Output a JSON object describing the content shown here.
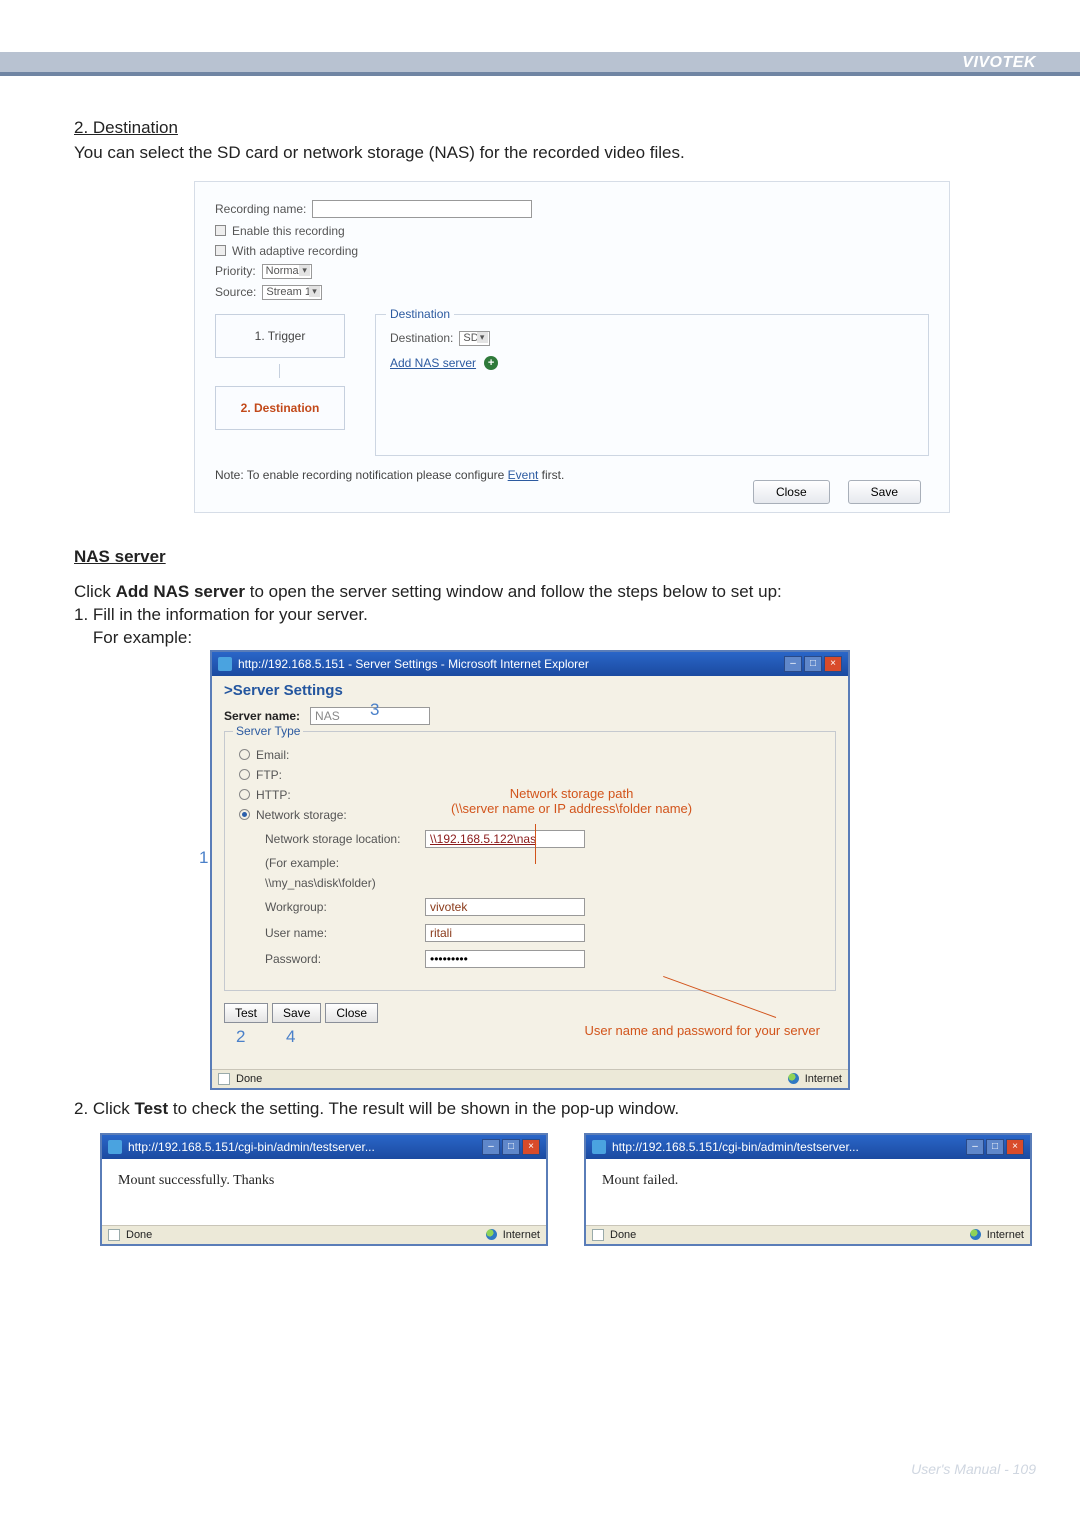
{
  "brand": "VIVOTEK",
  "sec_destination": {
    "heading": "2. Destination",
    "intro": "You can select the SD card or network storage (NAS) for the recorded video files."
  },
  "fig1": {
    "recording_name_label": "Recording name:",
    "recording_name_value": "",
    "enable_label": "Enable this recording",
    "adaptive_label": "With adaptive recording",
    "priority_label": "Priority:",
    "priority_value": "Normal",
    "source_label": "Source:",
    "source_value": "Stream 1",
    "step1": "1. Trigger",
    "step2": "2. Destination",
    "dest_legend": "Destination",
    "dest_label": "Destination:",
    "dest_value": "SD",
    "add_nas": "Add NAS server",
    "note_prefix": "Note: To enable recording notification please configure ",
    "note_link": "Event",
    "note_suffix": " first.",
    "btn_close": "Close",
    "btn_save": "Save"
  },
  "nas_heading": "NAS server",
  "nas_text_1": "Click ",
  "nas_text_bold": "Add NAS server",
  "nas_text_2": " to open the server setting window and follow the steps below to set up:",
  "step1_line": "1. Fill in the information for your server.",
  "example_line": "    For example:",
  "ie": {
    "title": "http://192.168.5.151 - Server Settings - Microsoft Internet Explorer",
    "heading": ">Server Settings",
    "server_name_label": "Server name:",
    "server_name_value": "NAS",
    "server_type_legend": "Server Type",
    "opt_email": "Email:",
    "opt_ftp": "FTP:",
    "opt_http": "HTTP:",
    "opt_ns": "Network storage:",
    "ns_loc_label": "Network storage location:",
    "ns_loc_value": "\\\\192.168.5.122\\nas",
    "example1": "(For example:",
    "example2": "\\\\my_nas\\disk\\folder)",
    "wg_label": "Workgroup:",
    "wg_value": "vivotek",
    "user_label": "User name:",
    "user_value": "ritali",
    "pw_label": "Password:",
    "pw_value": "•••••••••",
    "btn_test": "Test",
    "btn_save": "Save",
    "btn_close": "Close",
    "callout_path1": "Network storage path",
    "callout_path2": "(\\\\server name or IP address\\folder name)",
    "callout_cred": "User name and password for your server",
    "status_done": "Done",
    "status_net": "Internet",
    "badge1": "1",
    "badge2": "2",
    "badge3": "3",
    "badge4": "4"
  },
  "step2_line_a": "2. Click ",
  "step2_line_bold": "Test",
  "step2_line_b": " to check the setting. The result will be shown in the pop-up window.",
  "popup_title": "http://192.168.5.151/cgi-bin/admin/testserver...",
  "popup_ok": "Mount successfully. Thanks",
  "popup_fail": "Mount failed.",
  "footer_label": "User's Manual - ",
  "footer_page": "109"
}
